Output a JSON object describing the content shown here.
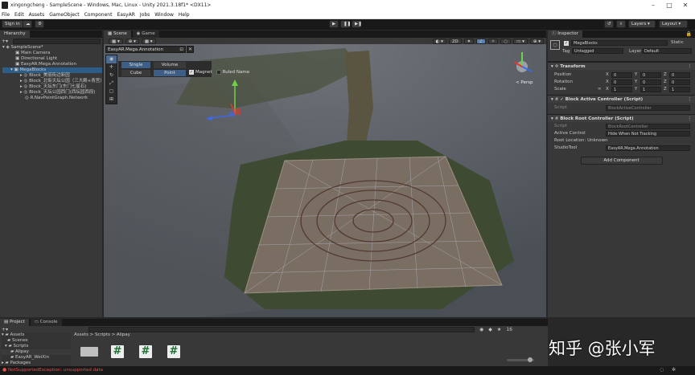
{
  "window": {
    "title": "xingongcheng - SampleScene - Windows, Mac, Linux - Unity 2021.3.18f1* <DX11>"
  },
  "menu": [
    "File",
    "Edit",
    "Assets",
    "GameObject",
    "Component",
    "EasyAR",
    "Jobs",
    "Window",
    "Help"
  ],
  "toolbar": {
    "signin": "Sign in",
    "layers": "Layers",
    "layout": "Layout"
  },
  "hierarchy": {
    "tab": "Hierarchy",
    "scene": "SampleScene*",
    "items": [
      "Main Camera",
      "Directional Light",
      "EasyAR.Mega.Annotation",
      "MegaBlocks",
      "Block_美丽街边新园",
      "Block_北街天坛公园（三大殿+青宫）",
      "Block_天坛东门(东门七星石)",
      "Block_天坛公园西门(西坛园西段)",
      "R.NavPointGraph.Network"
    ]
  },
  "scene_view": {
    "tabs": [
      "Scene",
      "Game"
    ],
    "mode_2d": "2D",
    "persp": "< Persp",
    "annotation": {
      "title": "EasyAR.Mega.Annotation",
      "single": "Single",
      "volume": "Volume",
      "cube": "Cube",
      "point": "Point",
      "magnet": "Magnet",
      "ruled": "Ruled Name"
    }
  },
  "inspector": {
    "tab": "Inspector",
    "name": "MegaBlocks",
    "static": "Static",
    "tag_label": "Tag",
    "tag_value": "Untagged",
    "layer_label": "Layer",
    "layer_value": "Default",
    "transform": {
      "title": "Transform",
      "rows": [
        {
          "label": "Position",
          "x": "0",
          "y": "0",
          "z": "0"
        },
        {
          "label": "Rotation",
          "x": "0",
          "y": "0",
          "z": "0"
        },
        {
          "label": "Scale",
          "x": "1",
          "y": "1",
          "z": "1"
        }
      ]
    },
    "c1": {
      "title": "Block Active Controller (Script)",
      "script_label": "Script",
      "script_value": "BlockActiveController"
    },
    "c2": {
      "title": "Block Root Controller (Script)",
      "script_label": "Script",
      "script_value": "BlockRootController",
      "active_label": "Active Control",
      "active_value": "Hide When Not Tracking",
      "root_location": "Root Location: Unknown",
      "studio_label": "StudioTool",
      "studio_value": "EasyAR.Mega.Annotation"
    },
    "add_component": "Add Component"
  },
  "project": {
    "tabs": [
      "Project",
      "Console"
    ],
    "tree": [
      "Assets",
      "Scenes",
      "Scripts",
      "Alipay",
      "EasyAR_WeiXin",
      "Packages"
    ],
    "breadcrumb": "Assets > Scripts > Alipay",
    "count": "16"
  },
  "status": {
    "error": "NotSupportedException: unsupported data"
  },
  "watermark": "知乎 @张小军"
}
